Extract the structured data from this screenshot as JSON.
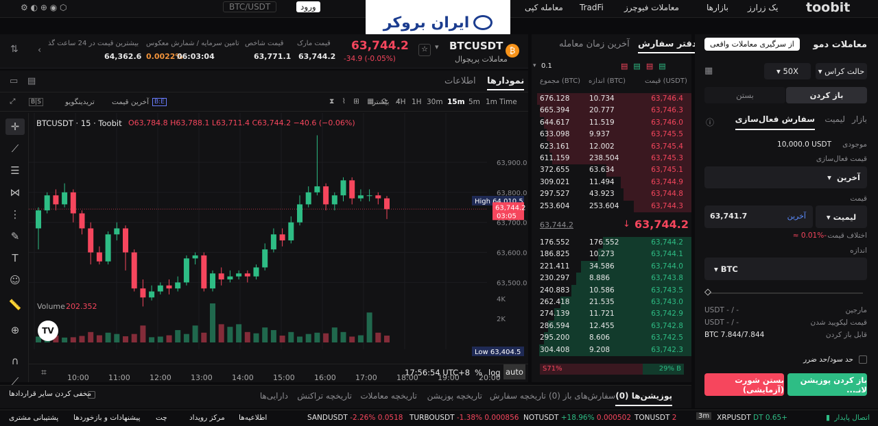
{
  "topbar": {
    "market": "بازارها",
    "trade_futures": "معاملات فیوچرز",
    "tradfi": "TradFi",
    "new_trade": "معامله کپی",
    "login": "ورود",
    "search": "BTC/USDT",
    "brand": "toobit",
    "extra": "یک زرارز"
  },
  "watermark": {
    "text": "ایران بروکر"
  },
  "ticker": {
    "symbol": "BTCUSDT",
    "subtitle": "معاملات پرپچوال",
    "price": "63,744.2",
    "change": "-34.9 (-0.05%)",
    "mark_label": "قیمت مارک",
    "mark": "63,744.2",
    "index_label": "قیمت شاخص",
    "index": "63,771.1",
    "funding_label": "تامین سرمایه / شمارش معکوس",
    "funding_rate": "0.0022%",
    "countdown": "06:03:04",
    "high_label": "بیشترین قیمت در 24 ساعت گذ",
    "high": "64,362.6"
  },
  "chart_tabs": {
    "chart": "نمودارها",
    "info": "اطلاعات"
  },
  "chart_toolbar": {
    "time_label": "Time",
    "intervals": [
      "1m",
      "5m",
      "15m",
      "30m",
      "1H",
      "4H"
    ],
    "more": "بیشتر",
    "last_price": "آخرین قیمت",
    "tradingview": "تریدینگویو"
  },
  "chart_data": {
    "type": "candlestick",
    "symbol": "BTCUSDT · 15 · Toobit",
    "ohlc": "O63,784.8 H63,788.1 L63,711.4 C63,744.2 −40.6 (−0.06%)",
    "y_ticks": [
      "63,900.0",
      "63,800.0",
      "63,700.0",
      "63,600.0",
      "63,500.0"
    ],
    "y_tick_values": [
      63900,
      63800,
      63700,
      63600,
      63500
    ],
    "x_ticks": [
      "10:00",
      "11:00",
      "12:00",
      "13:00",
      "14:00",
      "15:00",
      "16:00",
      "17:00",
      "18:00",
      "19:00",
      "20:00"
    ],
    "high_label": "High",
    "high": "64,010.5",
    "low_label": "Low",
    "low": "63,404.5",
    "last": "63,744.2",
    "last_countdown": "03:05",
    "ylim": [
      63380,
      64030
    ],
    "candles": [
      [
        63680,
        63740,
        63610,
        63750
      ],
      [
        63740,
        63790,
        63730,
        63800
      ],
      [
        63790,
        63760,
        63740,
        63810
      ],
      [
        63760,
        63800,
        63750,
        63830
      ],
      [
        63800,
        63730,
        63700,
        63810
      ],
      [
        63730,
        63680,
        63660,
        63740
      ],
      [
        63680,
        63600,
        63560,
        63700
      ],
      [
        63600,
        63570,
        63560,
        63620
      ],
      [
        63570,
        63660,
        63560,
        63670
      ],
      [
        63660,
        63680,
        63640,
        63700
      ],
      [
        63680,
        63600,
        63540,
        63690
      ],
      [
        63600,
        63480,
        63470,
        63610
      ],
      [
        63480,
        63450,
        63420,
        63510
      ],
      [
        63450,
        63470,
        63440,
        63490
      ],
      [
        63470,
        63490,
        63460,
        63500
      ],
      [
        63490,
        63480,
        63460,
        63510
      ],
      [
        63480,
        63500,
        63470,
        63520
      ],
      [
        63500,
        63580,
        63490,
        63590
      ],
      [
        63580,
        63590,
        63560,
        63600
      ],
      [
        63590,
        63480,
        63470,
        63600
      ],
      [
        63480,
        63530,
        63470,
        63540
      ],
      [
        63530,
        63510,
        63490,
        63550
      ],
      [
        63510,
        63520,
        63500,
        63540
      ],
      [
        63520,
        63530,
        63510,
        63540
      ],
      [
        63530,
        63520,
        63500,
        63540
      ],
      [
        63520,
        63550,
        63510,
        63560
      ],
      [
        63550,
        63610,
        63540,
        63630
      ],
      [
        63610,
        63660,
        63600,
        63680
      ],
      [
        63660,
        63640,
        63620,
        63680
      ],
      [
        63640,
        63700,
        63630,
        63720
      ],
      [
        63700,
        63760,
        63690,
        63790
      ],
      [
        63760,
        63800,
        63750,
        63820
      ],
      [
        63800,
        63820,
        63790,
        63990
      ],
      [
        63820,
        63760,
        63740,
        63830
      ],
      [
        63760,
        63790,
        63740,
        63800
      ],
      [
        63790,
        63840,
        63770,
        63850
      ],
      [
        63840,
        63780,
        63760,
        63850
      ],
      [
        63780,
        63790,
        63770,
        63810
      ],
      [
        63790,
        63790,
        63770,
        63810
      ],
      [
        63790,
        63780,
        63760,
        63800
      ],
      [
        63780,
        63744,
        63711,
        63788
      ]
    ],
    "volume_label": "Volume",
    "volume_value": "202.352",
    "vol_ticks": [
      "4K",
      "2K"
    ],
    "volumes": [
      180,
      220,
      210,
      150,
      160,
      200,
      320,
      220,
      300,
      260,
      190,
      260,
      520,
      160,
      180,
      220,
      380,
      260,
      520,
      300,
      1200,
      560,
      480,
      560,
      320,
      280,
      460,
      380,
      210,
      320,
      180,
      260,
      300,
      280,
      460,
      320,
      180,
      220,
      920,
      300,
      210
    ]
  },
  "chart_footer": {
    "clock": "17:56:54 UTC+8",
    "pct": "%",
    "log": "log",
    "auto": "auto"
  },
  "book": {
    "tab_book": "دفتر سفارش",
    "tab_trades": "آخرین زمان معامله",
    "precision": "0.1",
    "headers": {
      "price": "قیمت (USDT)",
      "size": "اندازه (BTC)",
      "total": "مجموع (BTC)"
    },
    "asks": [
      [
        "63,746.4",
        "10.734",
        "676.128"
      ],
      [
        "63,746.3",
        "20.777",
        "665.394"
      ],
      [
        "63,746.0",
        "11.519",
        "644.617"
      ],
      [
        "63,745.5",
        "9.937",
        "633.098"
      ],
      [
        "63,745.4",
        "12.002",
        "623.161"
      ],
      [
        "63,745.3",
        "238.504",
        "611.159"
      ],
      [
        "63,745.1",
        "63.634",
        "372.655"
      ],
      [
        "63,744.9",
        "11.494",
        "309.021"
      ],
      [
        "63,744.8",
        "43.923",
        "297.527"
      ],
      [
        "63,744.3",
        "253.604",
        "253.604"
      ]
    ],
    "mid_price": "63,744.2",
    "mark_small": "63,744.2",
    "bids": [
      [
        "63,744.2",
        "176.552",
        "176.552"
      ],
      [
        "63,744.1",
        "10.273",
        "186.825"
      ],
      [
        "63,744.0",
        "34.586",
        "221.411"
      ],
      [
        "63,743.8",
        "8.886",
        "230.297"
      ],
      [
        "63,743.5",
        "10.586",
        "240.883"
      ],
      [
        "63,743.0",
        "21.535",
        "262.418"
      ],
      [
        "63,742.9",
        "11.721",
        "274.139"
      ],
      [
        "63,742.8",
        "12.455",
        "286.594"
      ],
      [
        "63,742.5",
        "8.606",
        "295.200"
      ],
      [
        "63,742.3",
        "9.208",
        "304.408"
      ]
    ],
    "buy_ratio": "29% B",
    "sell_ratio": "S71%",
    "buy_fraction": 0.29
  },
  "order": {
    "title": "معاملات دمو",
    "real_btn": "از سرگیری معاملات واقعی",
    "margin_mode": "حالت کراس",
    "leverage": "50X",
    "open": "باز کردن",
    "close": "بستن",
    "tabs": [
      "بازار",
      "لیمیت",
      "سفارش فعال‌سازی"
    ],
    "balance_label": "موجودی",
    "balance": "10,000.0 USDT",
    "trigger_label": "قیمت فعال‌سازی",
    "trigger_type": "آخرین",
    "price_label": "قیمت",
    "price_type": "لیمیت",
    "price_value": "63,741.7",
    "price_source": "آخرین",
    "diff_label": "اختلاف قیمت",
    "diff": "-0.01% ≈",
    "size_label": "اندازه",
    "size_unit": "BTC",
    "margin_label": "مارجین",
    "margin_val": "USDT - / -",
    "liq_label": "قیمت لیکویید شدن",
    "liq_val": "USDT - / -",
    "openable_label": "قابل باز کردن",
    "openable_val": "BTC 7.844/7.844",
    "tpsl": "حد سود/حد ضرر",
    "long_btn": "باز کردن پوزیشن لانـ...",
    "short_btn": "بستن شورت (آزمایشی)"
  },
  "bottom_tabs": [
    "پوزیشن‌ها (0)",
    "سفارش‌های باز (0)",
    "تاریخچه سفارش",
    "تاریخچه پوزیشن",
    "تاریخچه معاملات",
    "تاریخچه تراکنش",
    "دارایی‌ها"
  ],
  "hide_others": "مخفی کردن سایر قراردادها",
  "status": {
    "connection": "اتصال پایدار",
    "tickers": [
      [
        "XRPUSDT",
        "DT 0.65+",
        ""
      ],
      [
        "TONUSDT",
        "2",
        ""
      ],
      [
        "NOTUSDT",
        "+18.96%",
        "0.000502"
      ],
      [
        "TURBOUSDT",
        "-1.38%",
        "0.000856"
      ],
      [
        "SANDUSDT",
        "-2.26%",
        "0.0518"
      ]
    ],
    "links": [
      "اطلاعیه‌ها",
      "مرکز رویداد",
      "چت",
      "پیشنهادات و بازخوردها",
      "پشتیبانی مشتری"
    ]
  },
  "colors": {
    "up": "#2ebd85",
    "down": "#f6465d",
    "bg": "#0b0b0d"
  }
}
